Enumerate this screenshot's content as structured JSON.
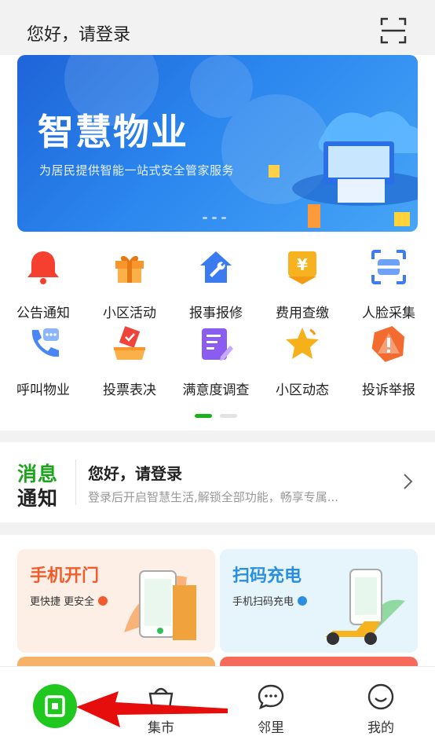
{
  "header": {
    "title": "您好，请登录",
    "scan_icon": "scan-icon"
  },
  "banner": {
    "title": "智慧物业",
    "subtitle": "为居民提供智能一站式安全管家服务"
  },
  "services": [
    {
      "label": "公告通知",
      "icon": "bell-icon",
      "color": "#f5402f"
    },
    {
      "label": "小区活动",
      "icon": "gift-icon",
      "color": "#f8962b"
    },
    {
      "label": "报事报修",
      "icon": "repair-house-icon",
      "color": "#3a7cf0"
    },
    {
      "label": "费用查缴",
      "icon": "yuan-shield-icon",
      "color": "#f6b21f"
    },
    {
      "label": "人脸采集",
      "icon": "face-scan-icon",
      "color": "#3d7cf4"
    },
    {
      "label": "呼叫物业",
      "icon": "phone-call-icon",
      "color": "#4a86f6"
    },
    {
      "label": "投票表决",
      "icon": "ballot-box-icon",
      "color": "#f0443a"
    },
    {
      "label": "满意度调查",
      "icon": "survey-icon",
      "color": "#8a5cf0"
    },
    {
      "label": "小区动态",
      "icon": "star-icon",
      "color": "#f6b11a"
    },
    {
      "label": "投诉举报",
      "icon": "complaint-icon",
      "color": "#f26b2f"
    }
  ],
  "notice": {
    "logo_line1": "消息",
    "logo_line2": "通知",
    "title": "您好，请登录",
    "subtitle": "登录后开启智慧生活,解锁全部功能，畅享专属..."
  },
  "cards": [
    {
      "title": "手机开门",
      "subtitle": "更快捷 更安全",
      "color": "#f45b2c"
    },
    {
      "title": "扫码充电",
      "subtitle": "手机扫码充电",
      "color": "#2a8fe0"
    }
  ],
  "tabbar": {
    "home_icon": "home-app-icon",
    "market": "集市",
    "neighbors": "邻里",
    "mine": "我的"
  }
}
